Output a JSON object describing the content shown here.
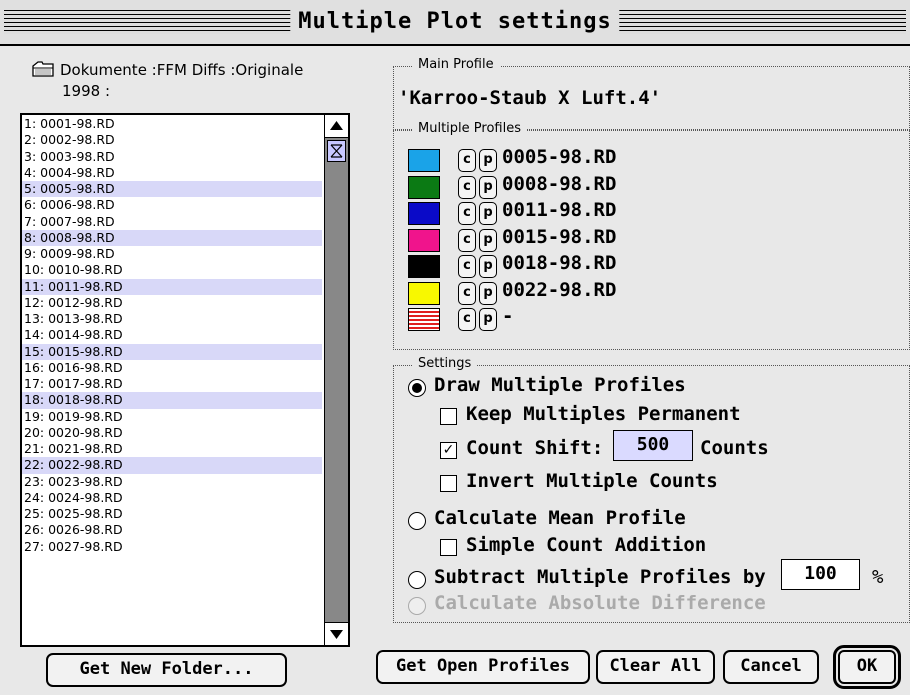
{
  "window": {
    "title": "Multiple Plot settings"
  },
  "folder": {
    "path_line1": "Dokumente :FFM Diffs :Originale",
    "path_line2": "1998 :",
    "icon": "folder-icon"
  },
  "file_list": {
    "items": [
      {
        "label": "1: 0001-98.RD",
        "selected": false
      },
      {
        "label": "2: 0002-98.RD",
        "selected": false
      },
      {
        "label": "3: 0003-98.RD",
        "selected": false
      },
      {
        "label": "4: 0004-98.RD",
        "selected": false
      },
      {
        "label": "5: 0005-98.RD",
        "selected": true
      },
      {
        "label": "6: 0006-98.RD",
        "selected": false
      },
      {
        "label": "7: 0007-98.RD",
        "selected": false
      },
      {
        "label": "8: 0008-98.RD",
        "selected": true
      },
      {
        "label": "9: 0009-98.RD",
        "selected": false
      },
      {
        "label": "10: 0010-98.RD",
        "selected": false
      },
      {
        "label": "11: 0011-98.RD",
        "selected": true
      },
      {
        "label": "12: 0012-98.RD",
        "selected": false
      },
      {
        "label": "13: 0013-98.RD",
        "selected": false
      },
      {
        "label": "14: 0014-98.RD",
        "selected": false
      },
      {
        "label": "15: 0015-98.RD",
        "selected": true
      },
      {
        "label": "16: 0016-98.RD",
        "selected": false
      },
      {
        "label": "17: 0017-98.RD",
        "selected": false
      },
      {
        "label": "18: 0018-98.RD",
        "selected": true
      },
      {
        "label": "19: 0019-98.RD",
        "selected": false
      },
      {
        "label": "20: 0020-98.RD",
        "selected": false
      },
      {
        "label": "21: 0021-98.RD",
        "selected": false
      },
      {
        "label": "22: 0022-98.RD",
        "selected": true
      },
      {
        "label": "23: 0023-98.RD",
        "selected": false
      },
      {
        "label": "24: 0024-98.RD",
        "selected": false
      },
      {
        "label": "25: 0025-98.RD",
        "selected": false
      },
      {
        "label": "26: 0026-98.RD",
        "selected": false
      },
      {
        "label": "27: 0027-98.RD",
        "selected": false
      }
    ],
    "selected_color": "#d8d8f8"
  },
  "main_profile": {
    "legend": "Main Profile",
    "value": "'Karroo-Staub X Luft.4'"
  },
  "multiple_profiles": {
    "legend": "Multiple Profiles",
    "c_label": "c",
    "p_label": "p",
    "rows": [
      {
        "color": "#1aa3e8",
        "name": "0005-98.RD"
      },
      {
        "color": "#0b7a14",
        "name": "0008-98.RD"
      },
      {
        "color": "#0a0ac8",
        "name": "0011-98.RD"
      },
      {
        "color": "#f0148c",
        "name": "0015-98.RD"
      },
      {
        "color": "#000000",
        "name": "0018-98.RD"
      },
      {
        "color": "#f8f800",
        "name": "0022-98.RD"
      },
      {
        "color": "striped-red",
        "name": "-"
      }
    ]
  },
  "settings": {
    "legend": "Settings",
    "draw_multiple": "Draw Multiple Profiles",
    "keep_permanent": "Keep Multiples Permanent",
    "count_shift": "Count Shift:",
    "count_shift_value": "500",
    "counts": "Counts",
    "invert_counts": "Invert Multiple Counts",
    "calc_mean": "Calculate Mean Profile",
    "simple_addition": "Simple Count Addition",
    "subtract": "Subtract Multiple Profiles by",
    "subtract_value": "100",
    "percent": "%",
    "abs_diff": "Calculate Absolute Difference"
  },
  "buttons": {
    "get_new_folder": "Get New Folder...",
    "get_open_profiles": "Get Open Profiles",
    "clear_all": "Clear All",
    "cancel": "Cancel",
    "ok": "OK"
  }
}
